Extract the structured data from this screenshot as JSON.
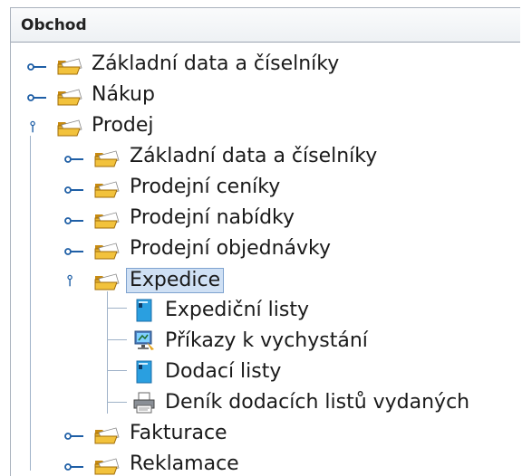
{
  "panel": {
    "title": "Obchod"
  },
  "tree": {
    "root_items": [
      {
        "label": "Základní data a číselníky",
        "state": "collapsed",
        "icon": "folder-icon"
      },
      {
        "label": "Nákup",
        "state": "collapsed",
        "icon": "folder-icon"
      },
      {
        "label": "Prodej",
        "state": "expanded",
        "icon": "folder-open-icon"
      }
    ],
    "prodej_items": [
      {
        "label": "Základní data a číselníky",
        "state": "collapsed",
        "icon": "folder-icon"
      },
      {
        "label": "Prodejní ceníky",
        "state": "collapsed",
        "icon": "folder-icon"
      },
      {
        "label": "Prodejní nabídky",
        "state": "collapsed",
        "icon": "folder-icon"
      },
      {
        "label": "Prodejní objednávky",
        "state": "collapsed",
        "icon": "folder-icon"
      },
      {
        "label": "Expedice",
        "state": "expanded",
        "icon": "folder-open-icon",
        "selected": true
      },
      {
        "label": "Fakturace",
        "state": "collapsed",
        "icon": "folder-icon"
      },
      {
        "label": "Reklamace",
        "state": "collapsed",
        "icon": "folder-icon"
      }
    ],
    "expedice_items": [
      {
        "label": "Expediční listy",
        "icon": "document-icon"
      },
      {
        "label": "Příkazy k vychystání",
        "icon": "monitor-icon"
      },
      {
        "label": "Dodací listy",
        "icon": "document-icon"
      },
      {
        "label": "Deník dodacích listů vydaných",
        "icon": "printer-icon"
      }
    ]
  },
  "colors": {
    "selection_bg": "#cfe0f4",
    "selection_border": "#7fa3cf",
    "tree_line": "#9fb2c8",
    "folder": "#e8b430"
  }
}
